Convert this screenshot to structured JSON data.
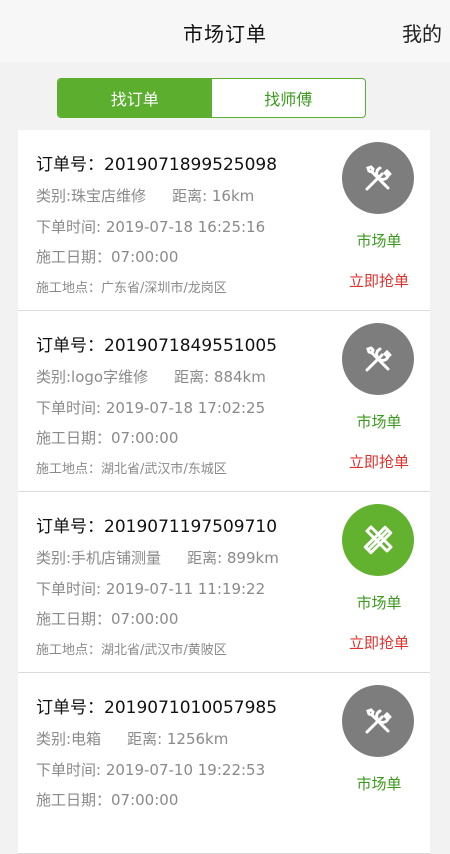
{
  "header": {
    "title": "市场订单",
    "right_tab": "我的"
  },
  "segments": [
    {
      "label": "找订单",
      "active": true
    },
    {
      "label": "找师傅",
      "active": false
    }
  ],
  "orders": [
    {
      "order_no": "订单号：2019071899525098",
      "category": "类别:珠宝店维修",
      "distance": "距离: 16km",
      "order_time": "下单时间: 2019-07-18 16:25:16",
      "work_date": "施工日期：07:00:00",
      "location": "施工地点：广东省/深圳市/龙岗区",
      "icon": "wrench-screwdriver-icon",
      "tag": "市场单",
      "action": "立即抢单"
    },
    {
      "order_no": "订单号：2019071849551005",
      "category": "类别:logo字维修",
      "distance": "距离: 884km",
      "order_time": "下单时间: 2019-07-18 17:02:25",
      "work_date": "施工日期：07:00:00",
      "location": "施工地点：湖北省/武汉市/东城区",
      "icon": "wrench-screwdriver-icon",
      "tag": "市场单",
      "action": "立即抢单"
    },
    {
      "order_no": "订单号：2019071197509710",
      "category": "类别:手机店铺测量",
      "distance": "距离: 899km",
      "order_time": "下单时间: 2019-07-11 11:19:22",
      "work_date": "施工日期：07:00:00",
      "location": "施工地点：湖北省/武汉市/黄陂区",
      "icon": "ruler-pencil-icon",
      "tag": "市场单",
      "action": "立即抢单"
    },
    {
      "order_no": "订单号：2019071010057985",
      "category": "类别:电箱",
      "distance": "距离: 1256km",
      "order_time": "下单时间: 2019-07-10 19:22:53",
      "work_date": "施工日期：07:00:00",
      "location": "",
      "icon": "wrench-screwdriver-icon",
      "tag": "市场单",
      "action": ""
    }
  ],
  "colors": {
    "accent": "#5cae2f",
    "grab": "#e0312c",
    "icon_gray": "#7d7d7d"
  }
}
